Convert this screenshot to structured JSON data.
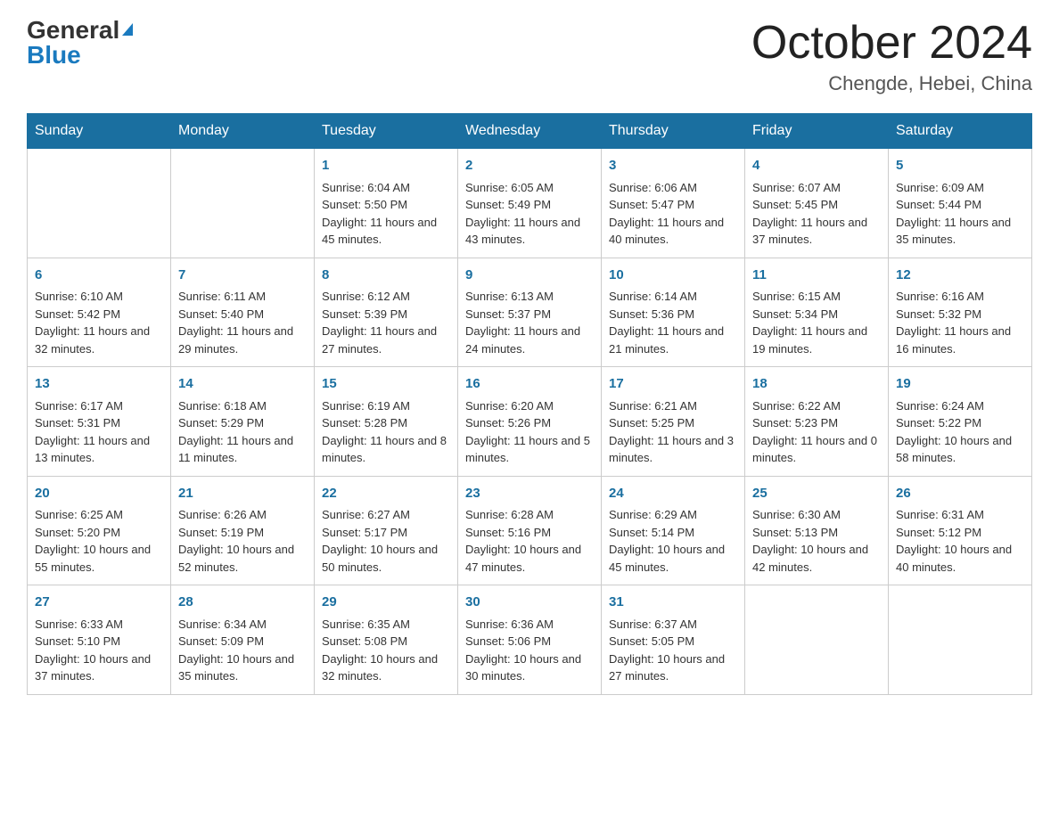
{
  "header": {
    "logo_general": "General",
    "logo_blue": "Blue",
    "month_title": "October 2024",
    "location": "Chengde, Hebei, China"
  },
  "days_of_week": [
    "Sunday",
    "Monday",
    "Tuesday",
    "Wednesday",
    "Thursday",
    "Friday",
    "Saturday"
  ],
  "weeks": [
    [
      null,
      null,
      {
        "day": "1",
        "sunrise": "Sunrise: 6:04 AM",
        "sunset": "Sunset: 5:50 PM",
        "daylight": "Daylight: 11 hours and 45 minutes."
      },
      {
        "day": "2",
        "sunrise": "Sunrise: 6:05 AM",
        "sunset": "Sunset: 5:49 PM",
        "daylight": "Daylight: 11 hours and 43 minutes."
      },
      {
        "day": "3",
        "sunrise": "Sunrise: 6:06 AM",
        "sunset": "Sunset: 5:47 PM",
        "daylight": "Daylight: 11 hours and 40 minutes."
      },
      {
        "day": "4",
        "sunrise": "Sunrise: 6:07 AM",
        "sunset": "Sunset: 5:45 PM",
        "daylight": "Daylight: 11 hours and 37 minutes."
      },
      {
        "day": "5",
        "sunrise": "Sunrise: 6:09 AM",
        "sunset": "Sunset: 5:44 PM",
        "daylight": "Daylight: 11 hours and 35 minutes."
      }
    ],
    [
      {
        "day": "6",
        "sunrise": "Sunrise: 6:10 AM",
        "sunset": "Sunset: 5:42 PM",
        "daylight": "Daylight: 11 hours and 32 minutes."
      },
      {
        "day": "7",
        "sunrise": "Sunrise: 6:11 AM",
        "sunset": "Sunset: 5:40 PM",
        "daylight": "Daylight: 11 hours and 29 minutes."
      },
      {
        "day": "8",
        "sunrise": "Sunrise: 6:12 AM",
        "sunset": "Sunset: 5:39 PM",
        "daylight": "Daylight: 11 hours and 27 minutes."
      },
      {
        "day": "9",
        "sunrise": "Sunrise: 6:13 AM",
        "sunset": "Sunset: 5:37 PM",
        "daylight": "Daylight: 11 hours and 24 minutes."
      },
      {
        "day": "10",
        "sunrise": "Sunrise: 6:14 AM",
        "sunset": "Sunset: 5:36 PM",
        "daylight": "Daylight: 11 hours and 21 minutes."
      },
      {
        "day": "11",
        "sunrise": "Sunrise: 6:15 AM",
        "sunset": "Sunset: 5:34 PM",
        "daylight": "Daylight: 11 hours and 19 minutes."
      },
      {
        "day": "12",
        "sunrise": "Sunrise: 6:16 AM",
        "sunset": "Sunset: 5:32 PM",
        "daylight": "Daylight: 11 hours and 16 minutes."
      }
    ],
    [
      {
        "day": "13",
        "sunrise": "Sunrise: 6:17 AM",
        "sunset": "Sunset: 5:31 PM",
        "daylight": "Daylight: 11 hours and 13 minutes."
      },
      {
        "day": "14",
        "sunrise": "Sunrise: 6:18 AM",
        "sunset": "Sunset: 5:29 PM",
        "daylight": "Daylight: 11 hours and 11 minutes."
      },
      {
        "day": "15",
        "sunrise": "Sunrise: 6:19 AM",
        "sunset": "Sunset: 5:28 PM",
        "daylight": "Daylight: 11 hours and 8 minutes."
      },
      {
        "day": "16",
        "sunrise": "Sunrise: 6:20 AM",
        "sunset": "Sunset: 5:26 PM",
        "daylight": "Daylight: 11 hours and 5 minutes."
      },
      {
        "day": "17",
        "sunrise": "Sunrise: 6:21 AM",
        "sunset": "Sunset: 5:25 PM",
        "daylight": "Daylight: 11 hours and 3 minutes."
      },
      {
        "day": "18",
        "sunrise": "Sunrise: 6:22 AM",
        "sunset": "Sunset: 5:23 PM",
        "daylight": "Daylight: 11 hours and 0 minutes."
      },
      {
        "day": "19",
        "sunrise": "Sunrise: 6:24 AM",
        "sunset": "Sunset: 5:22 PM",
        "daylight": "Daylight: 10 hours and 58 minutes."
      }
    ],
    [
      {
        "day": "20",
        "sunrise": "Sunrise: 6:25 AM",
        "sunset": "Sunset: 5:20 PM",
        "daylight": "Daylight: 10 hours and 55 minutes."
      },
      {
        "day": "21",
        "sunrise": "Sunrise: 6:26 AM",
        "sunset": "Sunset: 5:19 PM",
        "daylight": "Daylight: 10 hours and 52 minutes."
      },
      {
        "day": "22",
        "sunrise": "Sunrise: 6:27 AM",
        "sunset": "Sunset: 5:17 PM",
        "daylight": "Daylight: 10 hours and 50 minutes."
      },
      {
        "day": "23",
        "sunrise": "Sunrise: 6:28 AM",
        "sunset": "Sunset: 5:16 PM",
        "daylight": "Daylight: 10 hours and 47 minutes."
      },
      {
        "day": "24",
        "sunrise": "Sunrise: 6:29 AM",
        "sunset": "Sunset: 5:14 PM",
        "daylight": "Daylight: 10 hours and 45 minutes."
      },
      {
        "day": "25",
        "sunrise": "Sunrise: 6:30 AM",
        "sunset": "Sunset: 5:13 PM",
        "daylight": "Daylight: 10 hours and 42 minutes."
      },
      {
        "day": "26",
        "sunrise": "Sunrise: 6:31 AM",
        "sunset": "Sunset: 5:12 PM",
        "daylight": "Daylight: 10 hours and 40 minutes."
      }
    ],
    [
      {
        "day": "27",
        "sunrise": "Sunrise: 6:33 AM",
        "sunset": "Sunset: 5:10 PM",
        "daylight": "Daylight: 10 hours and 37 minutes."
      },
      {
        "day": "28",
        "sunrise": "Sunrise: 6:34 AM",
        "sunset": "Sunset: 5:09 PM",
        "daylight": "Daylight: 10 hours and 35 minutes."
      },
      {
        "day": "29",
        "sunrise": "Sunrise: 6:35 AM",
        "sunset": "Sunset: 5:08 PM",
        "daylight": "Daylight: 10 hours and 32 minutes."
      },
      {
        "day": "30",
        "sunrise": "Sunrise: 6:36 AM",
        "sunset": "Sunset: 5:06 PM",
        "daylight": "Daylight: 10 hours and 30 minutes."
      },
      {
        "day": "31",
        "sunrise": "Sunrise: 6:37 AM",
        "sunset": "Sunset: 5:05 PM",
        "daylight": "Daylight: 10 hours and 27 minutes."
      },
      null,
      null
    ]
  ]
}
